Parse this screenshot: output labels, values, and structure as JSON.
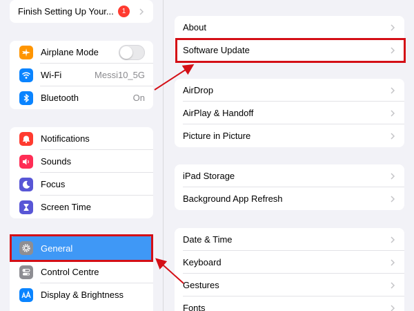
{
  "sidebar": {
    "setup": {
      "label": "Finish Setting Up Your...",
      "badge": "1"
    },
    "group1": [
      {
        "label": "Airplane Mode",
        "icon": "airplane-icon",
        "color": "#ff9500"
      },
      {
        "label": "Wi-Fi",
        "value": "Messi10_5G",
        "icon": "wifi-icon",
        "color": "#0a84ff"
      },
      {
        "label": "Bluetooth",
        "value": "On",
        "icon": "bluetooth-icon",
        "color": "#0a84ff"
      }
    ],
    "group2": [
      {
        "label": "Notifications",
        "icon": "bell-icon",
        "color": "#ff3b30"
      },
      {
        "label": "Sounds",
        "icon": "speaker-icon",
        "color": "#ff2d55"
      },
      {
        "label": "Focus",
        "icon": "moon-icon",
        "color": "#5856d6"
      },
      {
        "label": "Screen Time",
        "icon": "hourglass-icon",
        "color": "#5856d6"
      }
    ],
    "group3": [
      {
        "label": "General",
        "icon": "gear-icon",
        "color": "#8e8e93",
        "selected": true
      },
      {
        "label": "Control Centre",
        "icon": "switches-icon",
        "color": "#8e8e93"
      },
      {
        "label": "Display & Brightness",
        "icon": "text-size-icon",
        "color": "#0a84ff"
      }
    ]
  },
  "main": {
    "group1": [
      "About",
      "Software Update"
    ],
    "group2": [
      "AirDrop",
      "AirPlay & Handoff",
      "Picture in Picture"
    ],
    "group3": [
      "iPad Storage",
      "Background App Refresh"
    ],
    "group4": [
      "Date & Time",
      "Keyboard",
      "Gestures",
      "Fonts"
    ]
  },
  "colors": {
    "accent": "#3f98f6",
    "highlight": "#d40f16",
    "background": "#f2f2f7"
  }
}
